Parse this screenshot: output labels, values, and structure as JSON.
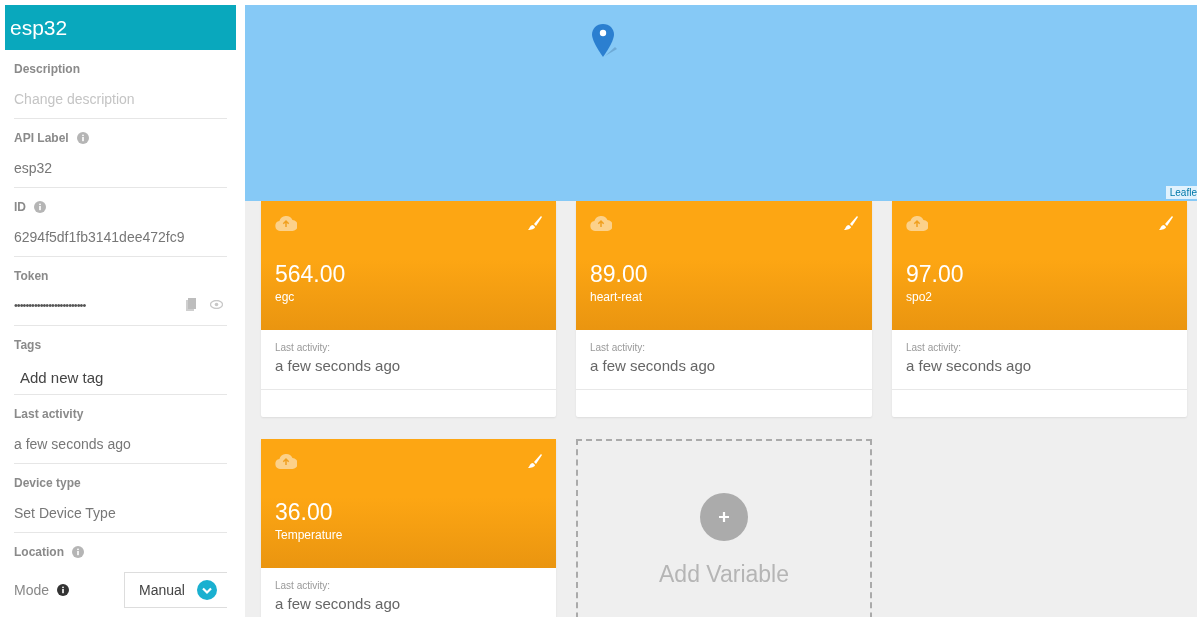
{
  "device": {
    "name": "esp32"
  },
  "sidebar": {
    "fields": [
      {
        "kind": "text",
        "label": "Description",
        "info": false,
        "placeholder": "Change description"
      },
      {
        "kind": "text",
        "label": "API Label",
        "info": true,
        "value": "esp32"
      },
      {
        "kind": "text",
        "label": "ID",
        "info": true,
        "value": "6294f5df1fb3141dee472fc9"
      },
      {
        "kind": "token",
        "label": "Token",
        "info": false,
        "value": "•••••••••••••••••••••••••"
      },
      {
        "kind": "tags",
        "label": "Tags",
        "info": false,
        "placeholder": "Add new tag"
      },
      {
        "kind": "text",
        "label": "Last activity",
        "info": false,
        "value": "a few seconds ago"
      },
      {
        "kind": "text",
        "label": "Device type",
        "info": false,
        "value": "Set Device Type"
      },
      {
        "kind": "location",
        "label": "Location",
        "info": true,
        "mode_label": "Mode",
        "mode_value": "Manual"
      }
    ]
  },
  "map": {
    "attribution": "Leafle"
  },
  "variables": [
    {
      "value": "564.00",
      "name": "egc",
      "activity_label": "Last activity:",
      "activity": "a few seconds ago"
    },
    {
      "value": "89.00",
      "name": "heart-reat",
      "activity_label": "Last activity:",
      "activity": "a few seconds ago"
    },
    {
      "value": "97.00",
      "name": "spo2",
      "activity_label": "Last activity:",
      "activity": "a few seconds ago"
    },
    {
      "value": "36.00",
      "name": "Temperature",
      "activity_label": "Last activity:",
      "activity": "a few seconds ago"
    }
  ],
  "add_variable": {
    "label": "Add Variable"
  }
}
